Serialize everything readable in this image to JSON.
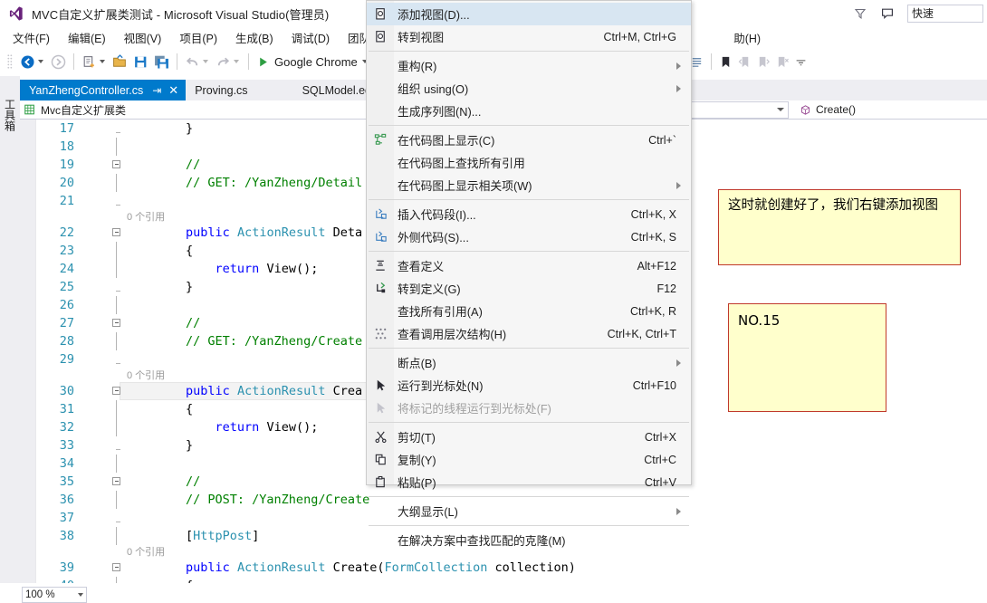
{
  "window": {
    "title": "MVC自定义扩展类测试 - Microsoft Visual Studio(管理员)",
    "logo_icon": "visual-studio-logo-icon",
    "feedback_icon": "feedback-smiley-icon",
    "notify_icon": "notification-bell-icon",
    "quick_launch_value": "快速",
    "quick_launch_placeholder": "快速启动 (Ctrl+Q)"
  },
  "menubar": {
    "items": [
      {
        "label": "文件(F)"
      },
      {
        "label": "编辑(E)"
      },
      {
        "label": "视图(V)"
      },
      {
        "label": "项目(P)"
      },
      {
        "label": "生成(B)"
      },
      {
        "label": "调试(D)"
      },
      {
        "label": "团队(N"
      },
      {
        "label": "助(H)"
      }
    ]
  },
  "toolbar": {
    "nav_back_icon": "navigate-back-icon",
    "nav_forward_icon": "navigate-forward-icon",
    "new_project_icon": "new-project-icon",
    "open_file_icon": "open-file-icon",
    "save_icon": "save-icon",
    "save_all_icon": "save-all-icon",
    "undo_icon": "undo-icon",
    "redo_icon": "redo-icon",
    "start_icon": "start-debug-play-icon",
    "start_label": "Google Chrome",
    "list_icon": "list-icon",
    "bookmark_icon": "bookmark-icon",
    "prev_bookmark_icon": "previous-bookmark-icon",
    "next_bookmark_icon": "next-bookmark-icon",
    "clear_bookmark_icon": "clear-bookmarks-icon",
    "overflow_icon": "toolbar-overflow-icon"
  },
  "left_dock": {
    "toolbox_label": "工具箱"
  },
  "tabs": {
    "items": [
      {
        "label": "YanZhengController.cs",
        "active": true,
        "pin_icon": "pin-icon",
        "close_icon": "close-icon"
      },
      {
        "label": "Proving.cs",
        "active": false
      },
      {
        "label": "SQLModel.ed",
        "active": false
      }
    ]
  },
  "navbar": {
    "project_icon": "project-cube-icon",
    "project_label": "Mvc自定义扩展类",
    "type_label": "",
    "member_icon": "method-cube-icon",
    "member_label": "Create()"
  },
  "editor": {
    "lines": [
      {
        "num": "17",
        "outline": "tick",
        "segments": [
          {
            "t": "        }",
            "c": "txt"
          }
        ]
      },
      {
        "num": "18",
        "outline": "line",
        "segments": []
      },
      {
        "num": "19",
        "outline": "box",
        "segments": [
          {
            "t": "        //",
            "c": "cmt"
          }
        ]
      },
      {
        "num": "20",
        "outline": "line",
        "segments": [
          {
            "t": "        // GET: /YanZheng/Detail",
            "c": "cmt"
          }
        ]
      },
      {
        "num": "21",
        "outline": "tick",
        "segments": []
      },
      {
        "num": "",
        "outline": "line",
        "lens": "0 个引用"
      },
      {
        "num": "22",
        "outline": "box",
        "segments": [
          {
            "t": "        ",
            "c": "txt"
          },
          {
            "t": "public",
            "c": "kw"
          },
          {
            "t": " ",
            "c": "txt"
          },
          {
            "t": "ActionResult",
            "c": "type"
          },
          {
            "t": " Deta",
            "c": "txt"
          }
        ]
      },
      {
        "num": "23",
        "outline": "line",
        "segments": [
          {
            "t": "        {",
            "c": "txt"
          }
        ]
      },
      {
        "num": "24",
        "outline": "line",
        "segments": [
          {
            "t": "            ",
            "c": "txt"
          },
          {
            "t": "return",
            "c": "kw"
          },
          {
            "t": " View();",
            "c": "txt"
          }
        ]
      },
      {
        "num": "25",
        "outline": "tick",
        "segments": [
          {
            "t": "        }",
            "c": "txt"
          }
        ]
      },
      {
        "num": "26",
        "outline": "line",
        "segments": []
      },
      {
        "num": "27",
        "outline": "box",
        "segments": [
          {
            "t": "        //",
            "c": "cmt"
          }
        ]
      },
      {
        "num": "28",
        "outline": "line",
        "segments": [
          {
            "t": "        // GET: /YanZheng/Create",
            "c": "cmt"
          }
        ]
      },
      {
        "num": "29",
        "outline": "tick",
        "segments": []
      },
      {
        "num": "",
        "outline": "line",
        "lens": "0 个引用"
      },
      {
        "num": "30",
        "outline": "box",
        "highlight": true,
        "segments": [
          {
            "t": "        ",
            "c": "txt"
          },
          {
            "t": "public",
            "c": "kw"
          },
          {
            "t": " ",
            "c": "txt"
          },
          {
            "t": "ActionResult",
            "c": "type"
          },
          {
            "t": " Crea",
            "c": "txt"
          }
        ]
      },
      {
        "num": "31",
        "outline": "line",
        "segments": [
          {
            "t": "        {",
            "c": "txt"
          }
        ]
      },
      {
        "num": "32",
        "outline": "line",
        "segments": [
          {
            "t": "            ",
            "c": "txt"
          },
          {
            "t": "return",
            "c": "kw"
          },
          {
            "t": " View();",
            "c": "txt"
          }
        ]
      },
      {
        "num": "33",
        "outline": "tick",
        "segments": [
          {
            "t": "        }",
            "c": "txt"
          }
        ]
      },
      {
        "num": "34",
        "outline": "line",
        "segments": []
      },
      {
        "num": "35",
        "outline": "box",
        "segments": [
          {
            "t": "        //",
            "c": "cmt"
          }
        ]
      },
      {
        "num": "36",
        "outline": "line",
        "segments": [
          {
            "t": "        // POST: /YanZheng/Create",
            "c": "cmt"
          }
        ]
      },
      {
        "num": "37",
        "outline": "tick",
        "segments": []
      },
      {
        "num": "38",
        "outline": "line",
        "segments": [
          {
            "t": "        [",
            "c": "txt"
          },
          {
            "t": "HttpPost",
            "c": "attr"
          },
          {
            "t": "]",
            "c": "txt"
          }
        ]
      },
      {
        "num": "",
        "outline": "line",
        "lens": "0 个引用"
      },
      {
        "num": "39",
        "outline": "box",
        "segments": [
          {
            "t": "        ",
            "c": "txt"
          },
          {
            "t": "public",
            "c": "kw"
          },
          {
            "t": " ",
            "c": "txt"
          },
          {
            "t": "ActionResult",
            "c": "type"
          },
          {
            "t": " Create(",
            "c": "txt"
          },
          {
            "t": "FormCollection",
            "c": "type"
          },
          {
            "t": " collection)",
            "c": "txt"
          }
        ]
      },
      {
        "num": "40",
        "outline": "line",
        "segments": [
          {
            "t": "        {",
            "c": "txt"
          }
        ]
      }
    ]
  },
  "context_menu": {
    "items": [
      {
        "label": "添加视图(D)...",
        "shortcut": "",
        "icon": "add-view-icon",
        "highlighted": true
      },
      {
        "label": "转到视图",
        "shortcut": "Ctrl+M, Ctrl+G",
        "icon": "go-to-view-icon"
      },
      {
        "separator": true
      },
      {
        "label": "重构(R)",
        "shortcut": "",
        "submenu": true
      },
      {
        "label": "组织 using(O)",
        "shortcut": "",
        "submenu": true
      },
      {
        "label": "生成序列图(N)...",
        "shortcut": ""
      },
      {
        "separator": true
      },
      {
        "label": "在代码图上显示(C)",
        "shortcut": "Ctrl+`",
        "icon": "code-map-icon"
      },
      {
        "label": "在代码图上查找所有引用",
        "shortcut": ""
      },
      {
        "label": "在代码图上显示相关项(W)",
        "shortcut": "",
        "submenu": true
      },
      {
        "separator": true
      },
      {
        "label": "插入代码段(I)...",
        "shortcut": "Ctrl+K, X",
        "icon": "insert-snippet-icon"
      },
      {
        "label": "外侧代码(S)...",
        "shortcut": "Ctrl+K, S",
        "icon": "surround-with-icon"
      },
      {
        "separator": true
      },
      {
        "label": "查看定义",
        "shortcut": "Alt+F12",
        "icon": "peek-definition-icon"
      },
      {
        "label": "转到定义(G)",
        "shortcut": "F12",
        "icon": "go-to-definition-icon"
      },
      {
        "label": "查找所有引用(A)",
        "shortcut": "Ctrl+K, R"
      },
      {
        "label": "查看调用层次结构(H)",
        "shortcut": "Ctrl+K, Ctrl+T",
        "icon": "call-hierarchy-icon"
      },
      {
        "separator": true
      },
      {
        "label": "断点(B)",
        "shortcut": "",
        "submenu": true
      },
      {
        "label": "运行到光标处(N)",
        "shortcut": "Ctrl+F10",
        "icon": "run-to-cursor-icon"
      },
      {
        "label": "将标记的线程运行到光标处(F)",
        "shortcut": "",
        "icon": "run-flagged-threads-icon",
        "disabled": true
      },
      {
        "separator": true
      },
      {
        "label": "剪切(T)",
        "shortcut": "Ctrl+X",
        "icon": "cut-scissors-icon"
      },
      {
        "label": "复制(Y)",
        "shortcut": "Ctrl+C",
        "icon": "copy-icon"
      },
      {
        "label": "粘贴(P)",
        "shortcut": "Ctrl+V",
        "icon": "paste-icon"
      },
      {
        "separator": true
      },
      {
        "label": "大纲显示(L)",
        "shortcut": "",
        "submenu": true
      },
      {
        "separator": true
      },
      {
        "label": "在解决方案中查找匹配的克隆(M)",
        "shortcut": ""
      }
    ]
  },
  "notes": [
    {
      "text": "这时就创建好了，我们右键添加视图"
    },
    {
      "text": "NO.15"
    }
  ],
  "status": {
    "zoom_level": "100 %"
  },
  "colors": {
    "accent_blue": "#007acc",
    "menu_highlight": "#d8e6f2",
    "note_bg": "#ffffcc",
    "note_border": "#c0392b",
    "chrome_bg": "#eeeef2",
    "keyword": "#0000ff",
    "type": "#2b91af",
    "comment": "#008000",
    "linenumber": "#2b91af"
  }
}
